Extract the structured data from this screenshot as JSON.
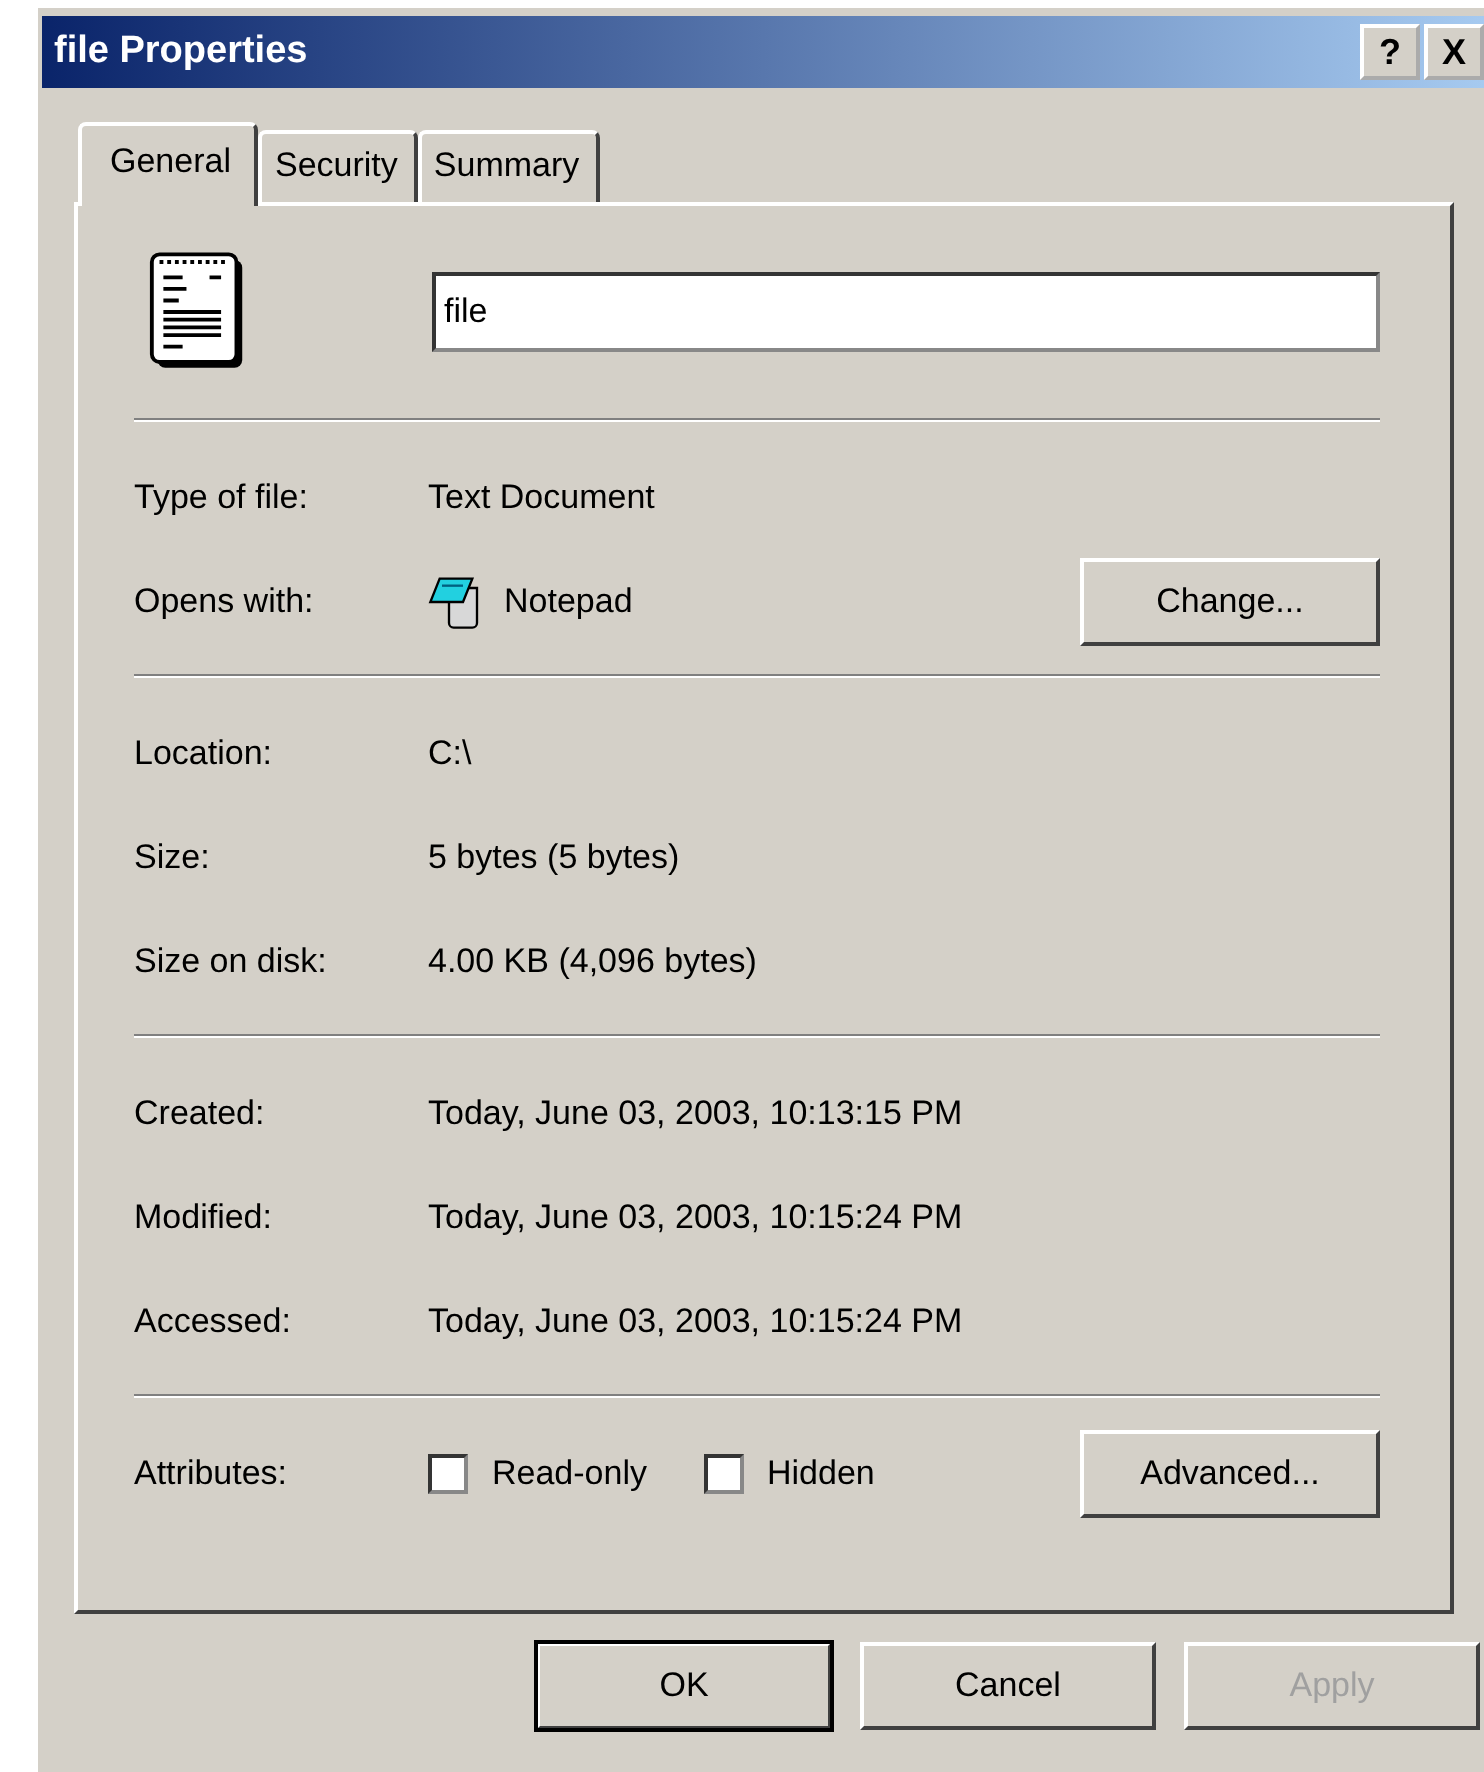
{
  "window": {
    "title": "file Properties",
    "help_button": "?",
    "close_button": "X"
  },
  "tabs": [
    {
      "label": "General",
      "selected": true
    },
    {
      "label": "Security",
      "selected": false
    },
    {
      "label": "Summary",
      "selected": false
    }
  ],
  "name_field": {
    "value": "file"
  },
  "sections": [
    {
      "rows": [
        {
          "kind": "text",
          "label": "Type of file:",
          "value": "Text Document"
        },
        {
          "kind": "app",
          "label": "Opens with:",
          "value": "Notepad",
          "button": "Change..."
        }
      ]
    },
    {
      "rows": [
        {
          "kind": "text",
          "label": "Location:",
          "value": "C:\\"
        },
        {
          "kind": "text",
          "label": "Size:",
          "value": "5 bytes (5 bytes)"
        },
        {
          "kind": "text",
          "label": "Size on disk:",
          "value": "4.00 KB (4,096 bytes)"
        }
      ]
    },
    {
      "rows": [
        {
          "kind": "text",
          "label": "Created:",
          "value": "Today, June 03, 2003, 10:13:15 PM"
        },
        {
          "kind": "text",
          "label": "Modified:",
          "value": "Today, June 03, 2003, 10:15:24 PM"
        },
        {
          "kind": "text",
          "label": "Accessed:",
          "value": "Today, June 03, 2003, 10:15:24 PM"
        }
      ]
    },
    {
      "rows": [
        {
          "kind": "attributes",
          "label": "Attributes:",
          "checkboxes": [
            {
              "label": "Read-only",
              "checked": false
            },
            {
              "label": "Hidden",
              "checked": false
            }
          ],
          "button": "Advanced..."
        }
      ]
    }
  ],
  "buttons": [
    {
      "label": "OK",
      "disabled": false,
      "default": true
    },
    {
      "label": "Cancel",
      "disabled": false,
      "default": false
    },
    {
      "label": "Apply",
      "disabled": true,
      "default": false
    }
  ]
}
